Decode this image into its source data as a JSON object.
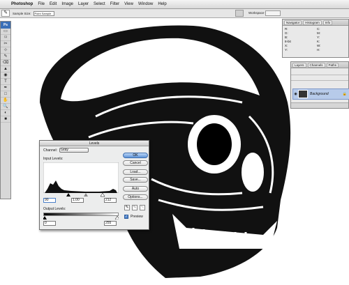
{
  "menubar": {
    "app": "Photoshop",
    "items": [
      "File",
      "Edit",
      "Image",
      "Layer",
      "Select",
      "Filter",
      "View",
      "Window",
      "Help"
    ]
  },
  "options": {
    "sample_label": "Sample Size:",
    "sample_value": "Point Sample",
    "workspace": "Workspace ▾"
  },
  "toolbox": {
    "logo": "Ps",
    "tools": [
      "▭",
      "⌑",
      "✂",
      "⊹",
      "✎",
      "⌫",
      "▲",
      "◉",
      "T",
      "✒",
      "□",
      "✋",
      "🔍",
      "◐",
      "■"
    ]
  },
  "info_panel": {
    "tabs": [
      "Navigator",
      "Histogram",
      "Info"
    ],
    "values": [
      "R:",
      "G:",
      "B:",
      "8-bit",
      "X:",
      "Y:",
      "C:",
      "M:",
      "Y:",
      "K:",
      "8-bit",
      "W:",
      "H:"
    ]
  },
  "layers_panel": {
    "tabs": [
      "Layers",
      "Channels",
      "Paths"
    ],
    "layer_name": "Background"
  },
  "levels": {
    "title": "Levels",
    "channel_label": "Channel:",
    "channel_value": "Gray",
    "input_label": "Input Levels:",
    "input_black": "90",
    "input_gamma": "1.00",
    "input_white": "212",
    "output_label": "Output Levels:",
    "output_black": "0",
    "output_white": "255",
    "buttons": {
      "ok": "OK",
      "cancel": "Cancel",
      "load": "Load...",
      "save": "Save...",
      "auto": "Auto",
      "options": "Options..."
    },
    "preview_label": "Preview"
  },
  "colors": {
    "accent": "#5e93d7",
    "selection": "#b7cbea"
  }
}
